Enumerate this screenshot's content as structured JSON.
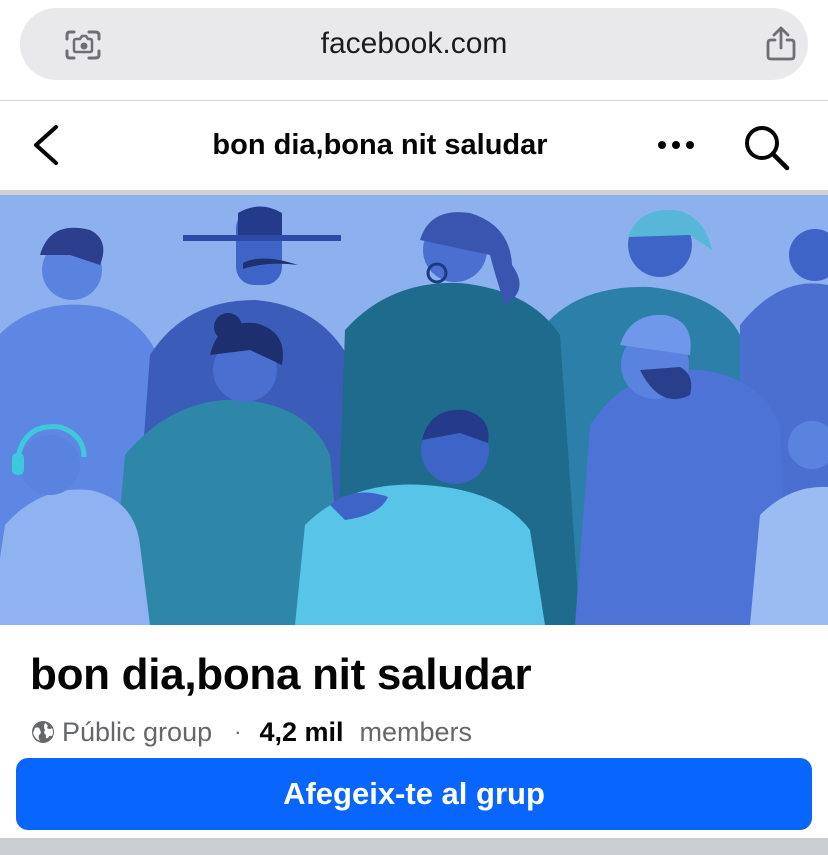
{
  "browser": {
    "url": "facebook.com",
    "icons": {
      "left": "visual-lookup-icon",
      "right": "share-icon"
    }
  },
  "header": {
    "title": "bon dia,bona nit saludar",
    "icons": {
      "back": "chevron-left-icon",
      "more": "more-dots-icon",
      "search": "search-icon"
    }
  },
  "cover": {
    "illustration": "group-of-people-illustration"
  },
  "group": {
    "name": "bon dia,bona nit saludar",
    "privacy": "Públic group",
    "separator": "·",
    "member_count": "4,2 mil",
    "members_label": "members",
    "join_label": "Afegeix-te al grup"
  },
  "colors": {
    "primary_button": "#0866ff",
    "cover_background": "#8db0ef",
    "secondary_text": "#65676b"
  }
}
